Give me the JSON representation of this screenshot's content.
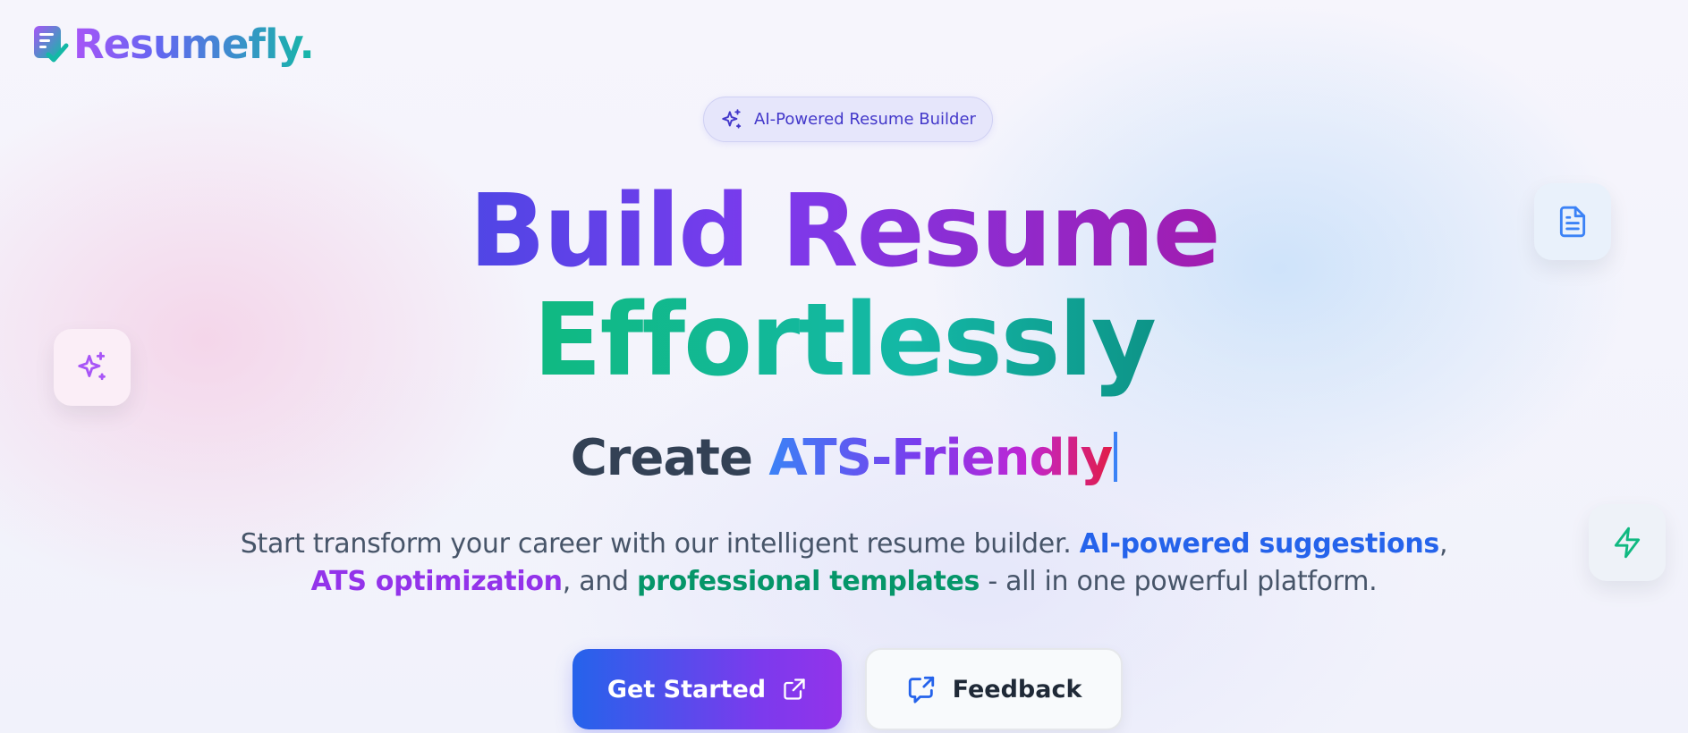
{
  "brand": {
    "name": "Resumefly.",
    "icon": "resume-check-icon"
  },
  "badge": {
    "icon": "sparkles-icon",
    "label": "AI-Powered Resume Builder"
  },
  "hero": {
    "line1": "Build Resume",
    "line2": "Effortlessly",
    "subhead_prefix": "Create ",
    "subhead_typed": "ATS-Friendly",
    "description": {
      "part1": "Start transform your career with our intelligent resume builder. ",
      "highlight1": "AI-powered suggestions",
      "part2": ",",
      "highlight2": "ATS optimization",
      "part3": ", and ",
      "highlight3": "professional templates",
      "part4": " - all in one powerful platform."
    }
  },
  "actions": {
    "primary_label": "Get Started",
    "primary_icon": "external-link-icon",
    "secondary_label": "Feedback",
    "secondary_icon": "message-share-icon"
  },
  "floating_cards": [
    {
      "icon": "sparkles-icon",
      "color": "#a855f7"
    },
    {
      "icon": "document-icon",
      "color": "#3b82f6"
    },
    {
      "icon": "lightning-bolt-icon",
      "color": "#10b981"
    }
  ],
  "colors": {
    "brand_purple": "#7c3aed",
    "brand_teal": "#14b8a6",
    "accent_blue": "#2563eb",
    "accent_purple": "#9333ea",
    "accent_green": "#059669"
  }
}
